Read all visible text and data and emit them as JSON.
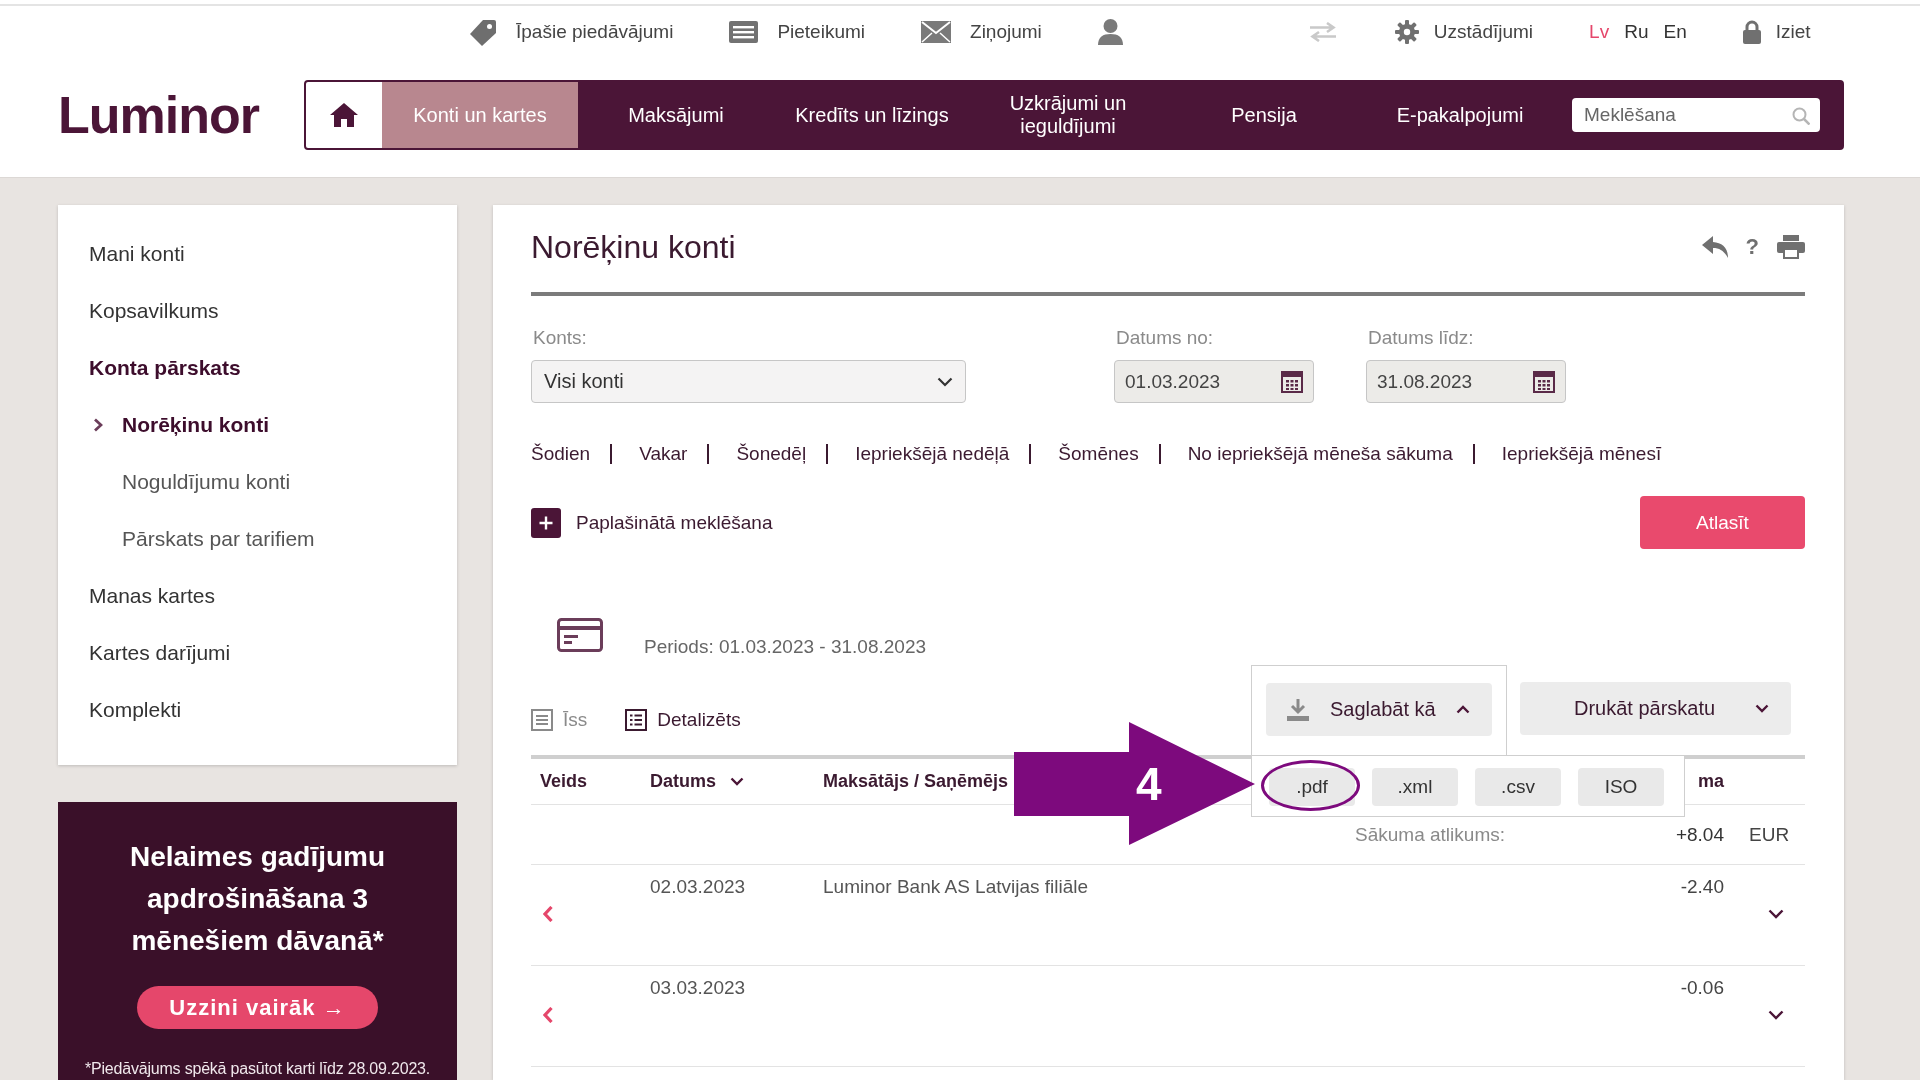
{
  "top_bar": {
    "offers": "Īpašie piedāvājumi",
    "applications": "Pieteikumi",
    "messages": "Ziņojumi",
    "settings": "Uzstādījumi",
    "languages": [
      {
        "label": "Lv",
        "selected": true
      },
      {
        "label": "Ru",
        "selected": false
      },
      {
        "label": "En",
        "selected": false
      }
    ],
    "logout": "Iziet"
  },
  "logo": "Luminor",
  "nav": {
    "items": [
      {
        "label": "Konti un kartes",
        "selected": true
      },
      {
        "label": "Maksājumi",
        "selected": false
      },
      {
        "label": "Kredīts un līzings",
        "selected": false
      },
      {
        "label": "Uzkrājumi un ieguldījumi",
        "selected": false
      },
      {
        "label": "Pensija",
        "selected": false
      },
      {
        "label": "E-pakalpojumi",
        "selected": false
      }
    ],
    "search": {
      "placeholder": "Meklēšana"
    }
  },
  "sidebar": {
    "items": [
      {
        "label": "Mani konti",
        "expanded": false
      },
      {
        "label": "Kopsavilkums",
        "expanded": false
      },
      {
        "label": "Konta pārskats",
        "expanded": true,
        "children": [
          {
            "label": "Norēķinu konti",
            "selected": true
          },
          {
            "label": "Noguldījumu konti",
            "selected": false
          },
          {
            "label": "Pārskats par tarifiem",
            "selected": false
          }
        ]
      },
      {
        "label": "Manas kartes",
        "expanded": false
      },
      {
        "label": "Kartes darījumi",
        "expanded": false
      },
      {
        "label": "Komplekti",
        "expanded": false
      }
    ]
  },
  "promo": {
    "headline": "Nelaimes gadījumu apdrošināšana 3 mēnešiem dāvanā*",
    "button": "Uzzini vairāk →",
    "footnote": "*Piedāvājums spēkā pasūtot karti līdz 28.09.2023."
  },
  "main": {
    "title": "Norēķinu konti",
    "help_button": "?",
    "filters": {
      "account": {
        "label": "Konts:",
        "value": "Visi konti"
      },
      "date_from": {
        "label": "Datums no:",
        "value": "01.03.2023"
      },
      "date_to": {
        "label": "Datums līdz:",
        "value": "31.08.2023"
      }
    },
    "quick_ranges": [
      "Šodien",
      "Vakar",
      "Šonedēļ",
      "Iepriekšējā nedēļā",
      "Šomēnes",
      "No iepriekšējā mēneša sākuma",
      "Iepriekšējā mēnesī"
    ],
    "advanced_search": "Paplašinātā meklēšana",
    "submit_button": "Atlasīt",
    "period": "Periods: 01.03.2023 - 31.08.2023",
    "views": [
      {
        "label": "Īss",
        "selected": false
      },
      {
        "label": "Detalizēts",
        "selected": true
      }
    ],
    "save_button": {
      "label": "Saglabāt kā",
      "expanded": true
    },
    "export_formats": [
      {
        "label": ".pdf",
        "highlighted": true
      },
      {
        "label": ".xml",
        "highlighted": false
      },
      {
        "label": ".csv",
        "highlighted": false
      },
      {
        "label": "ISO",
        "highlighted": false
      }
    ],
    "print_button": {
      "label": "Drukāt pārskatu",
      "expanded": false
    },
    "table": {
      "columns": [
        {
          "label": "Veids",
          "sorted": false
        },
        {
          "label": "Datums",
          "sorted": true
        },
        {
          "label": "Maksātājs / Saņēmējs",
          "sorted": false
        },
        {
          "label": "ma",
          "sorted": false
        }
      ],
      "opening_balance": {
        "label": "Sākuma atlikums:",
        "amount": "+8.04",
        "currency": "EUR"
      },
      "rows": [
        {
          "date": "02.03.2023",
          "party": "Luminor Bank AS Latvijas filiāle",
          "amount": "-2.40",
          "expanded": false
        },
        {
          "date": "03.03.2023",
          "amount": "-0.06",
          "expanded": false
        }
      ]
    }
  },
  "annotation": {
    "step": "4"
  }
}
